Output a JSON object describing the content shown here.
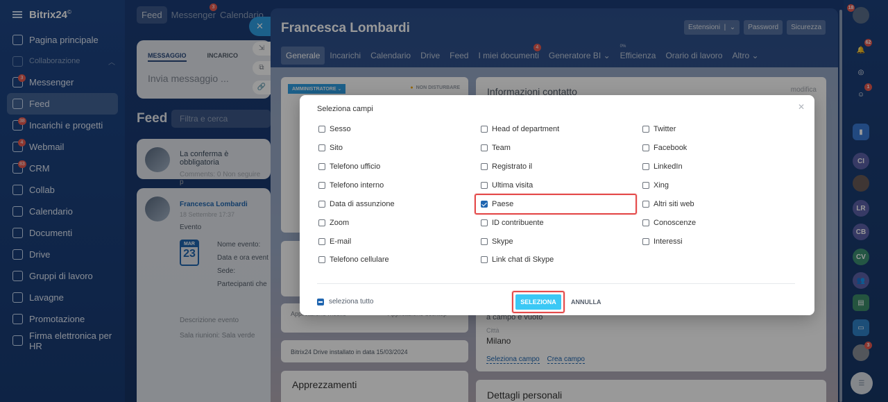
{
  "app": {
    "brand": "Bitrix24",
    "brand_mark": "©"
  },
  "sidebar": {
    "items": [
      {
        "label": "Pagina principale",
        "badge": ""
      },
      {
        "label": "Collaborazione",
        "badge": ""
      },
      {
        "label": "Messenger",
        "badge": "3"
      },
      {
        "label": "Feed",
        "badge": ""
      },
      {
        "label": "Incarichi e progetti",
        "badge": "38"
      },
      {
        "label": "Webmail",
        "badge": "4"
      },
      {
        "label": "CRM",
        "badge": "83"
      },
      {
        "label": "Collab",
        "badge": ""
      },
      {
        "label": "Calendario",
        "badge": ""
      },
      {
        "label": "Documenti",
        "badge": ""
      },
      {
        "label": "Drive",
        "badge": ""
      },
      {
        "label": "Gruppi di lavoro",
        "badge": ""
      },
      {
        "label": "Lavagne",
        "badge": ""
      },
      {
        "label": "Promotazione",
        "badge": ""
      },
      {
        "label": "Firma elettronica per HR",
        "badge": ""
      }
    ]
  },
  "topbar": {
    "feed": "Feed",
    "messenger": "Messenger",
    "messenger_badge": "3",
    "calendar": "Calendario"
  },
  "feed": {
    "tab_message": "MESSAGGIO",
    "tab_task": "INCARICO",
    "message_placeholder": "Invia messaggio ...",
    "title": "Feed",
    "filter_placeholder": "Filtra e cerca",
    "post1_text": "La conferma è obbligatoria",
    "post1_sub": "Comments: 0   Non seguire p",
    "post2_author": "Francesca Lombardi",
    "post2_date": "18 Settembre 17:37",
    "post2_type": "Evento",
    "cal_day": "23",
    "evt_name": "Nome evento:",
    "evt_datetime": "Data e ora event",
    "evt_place": "Sede:",
    "evt_participants": "Partecipanti che",
    "evt_extra1": "Descrizione evento",
    "evt_extra2": "Sala riunioni: Sala verde"
  },
  "slider": {
    "title": "Francesca Lombardi",
    "buttons": {
      "extensions": "Estensioni",
      "password": "Password",
      "security": "Sicurezza"
    },
    "tabs": [
      {
        "label": "Generale",
        "badge": ""
      },
      {
        "label": "Incarichi",
        "badge": ""
      },
      {
        "label": "Calendario",
        "badge": ""
      },
      {
        "label": "Drive",
        "badge": ""
      },
      {
        "label": "Feed",
        "badge": ""
      },
      {
        "label": "I miei documenti",
        "badge": "4"
      },
      {
        "label": "Generatore BI ⌄",
        "badge": ""
      },
      {
        "label": "Efficienza",
        "badge": "",
        "pct": "0%"
      },
      {
        "label": "Orario di lavoro",
        "badge": ""
      },
      {
        "label": "Altro ⌄",
        "badge": ""
      }
    ],
    "admin_tag": "AMMINISTRATORE ⌄",
    "status": "NON DISTURBARE",
    "contact_title": "Informazioni contatto",
    "modify": "modifica",
    "app_mobile": "Applicazione mobile",
    "app_desktop": "Applicazione desktop",
    "drive_note": "Bitrix24 Drive installato in data 15/03/2024",
    "appreciations": "Apprezzamenti",
    "field_hint": "a campo e vuoto",
    "city_label": "Città",
    "city_value": "Milano",
    "select_field": "Seleziona campo",
    "create_field": "Crea campo",
    "personal_details": "Dettagli personali"
  },
  "modal": {
    "title": "Seleziona campi",
    "columns": [
      [
        {
          "label": "Sesso",
          "checked": false
        },
        {
          "label": "Sito",
          "checked": false
        },
        {
          "label": "Telefono ufficio",
          "checked": false
        },
        {
          "label": "Telefono interno",
          "checked": false
        },
        {
          "label": "Data di assunzione",
          "checked": false
        },
        {
          "label": "Zoom",
          "checked": false
        },
        {
          "label": "E-mail",
          "checked": false
        },
        {
          "label": "Telefono cellulare",
          "checked": false
        }
      ],
      [
        {
          "label": "Head of department",
          "checked": false
        },
        {
          "label": "Team",
          "checked": false
        },
        {
          "label": "Registrato il",
          "checked": false
        },
        {
          "label": "Ultima visita",
          "checked": false
        },
        {
          "label": "Paese",
          "checked": true
        },
        {
          "label": "ID contribuente",
          "checked": false
        },
        {
          "label": "Skype",
          "checked": false
        },
        {
          "label": "Link chat di Skype",
          "checked": false
        }
      ],
      [
        {
          "label": "Twitter",
          "checked": false
        },
        {
          "label": "Facebook",
          "checked": false
        },
        {
          "label": "LinkedIn",
          "checked": false
        },
        {
          "label": "Xing",
          "checked": false
        },
        {
          "label": "Altri siti web",
          "checked": false
        },
        {
          "label": "Conoscenze",
          "checked": false
        },
        {
          "label": "Interessi",
          "checked": false
        }
      ]
    ],
    "select_all": "seleziona tutto",
    "confirm": "SELEZIONA",
    "cancel": "ANNULLA"
  },
  "rail": {
    "badges": {
      "notifications": "62",
      "chat": "1",
      "user": "3",
      "top": "18"
    },
    "avatars": [
      "CI",
      "LR",
      "CB",
      "CV"
    ]
  },
  "colors": {
    "accent": "#3bc8f5",
    "highlight": "#e44b4b",
    "brand_blue": "#2066b0"
  }
}
